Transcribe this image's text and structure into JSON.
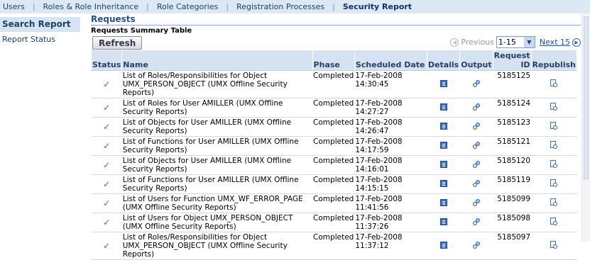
{
  "top_nav": {
    "tabs": [
      "Users",
      "Roles & Role Inheritance",
      "Role Categories",
      "Registration Processes",
      "Security Report"
    ],
    "active": "Security Report"
  },
  "side_nav": {
    "items": [
      "Search Report",
      "Report Status"
    ],
    "active": "Search Report"
  },
  "section": {
    "title": "Requests",
    "subtitle": "Requests Summary Table"
  },
  "controls": {
    "refresh_label": "Refresh",
    "previous_label": "Previous",
    "range_value": "1-15",
    "next_label": "Next 15"
  },
  "table": {
    "headers": {
      "status": "Status",
      "name": "Name",
      "phase": "Phase",
      "scheduled_date": "Scheduled Date",
      "details": "Details",
      "output": "Output",
      "request_id": "Request ID",
      "republish": "Republish"
    },
    "rows": [
      {
        "status": "completed",
        "name": "List of Roles/Responsibilities for Object UMX_PERSON_OBJECT (UMX Offline Security Reports)",
        "phase": "Completed",
        "scheduled_date": "17-Feb-2008 14:30:45",
        "request_id": "5185125"
      },
      {
        "status": "completed",
        "name": "List of Roles for User AMILLER (UMX Offline Security Reports)",
        "phase": "Completed",
        "scheduled_date": "17-Feb-2008 14:27:27",
        "request_id": "5185124"
      },
      {
        "status": "completed",
        "name": "List of Objects for User AMILLER (UMX Offline Security Reports)",
        "phase": "Completed",
        "scheduled_date": "17-Feb-2008 14:26:47",
        "request_id": "5185123"
      },
      {
        "status": "completed",
        "name": "List of Functions for User AMILLER (UMX Offline Security Reports)",
        "phase": "Completed",
        "scheduled_date": "17-Feb-2008 14:17:59",
        "request_id": "5185121"
      },
      {
        "status": "completed",
        "name": "List of Objects for User AMILLER (UMX Offline Security Reports)",
        "phase": "Completed",
        "scheduled_date": "17-Feb-2008 14:16:01",
        "request_id": "5185120"
      },
      {
        "status": "completed",
        "name": "List of Functions for User AMILLER (UMX Offline Security Reports)",
        "phase": "Completed",
        "scheduled_date": "17-Feb-2008 14:15:15",
        "request_id": "5185119"
      },
      {
        "status": "completed",
        "name": "List of Users for Function UMX_WF_ERROR_PAGE (UMX Offline Security Reports)",
        "phase": "Completed",
        "scheduled_date": "17-Feb-2008 11:41:56",
        "request_id": "5185099"
      },
      {
        "status": "completed",
        "name": "List of Users for Object UMX_PERSON_OBJECT (UMX Offline Security Reports)",
        "phase": "Completed",
        "scheduled_date": "17-Feb-2008 11:37:26",
        "request_id": "5185098"
      },
      {
        "status": "completed",
        "name": "List of Roles/Responsibilities for Object UMX_PERSON_OBJECT (UMX Offline Security Reports)",
        "phase": "Completed",
        "scheduled_date": "17-Feb-2008 11:37:12",
        "request_id": "5185097"
      }
    ]
  },
  "icons": {
    "status": "check-icon",
    "details": "details-icon",
    "output": "output-icon",
    "republish": "republish-icon"
  },
  "colors": {
    "header_bg": "#d5e2f1",
    "nav_bg": "#dde8f5",
    "check": "#2f8f2f",
    "link": "#1b4f9c"
  }
}
